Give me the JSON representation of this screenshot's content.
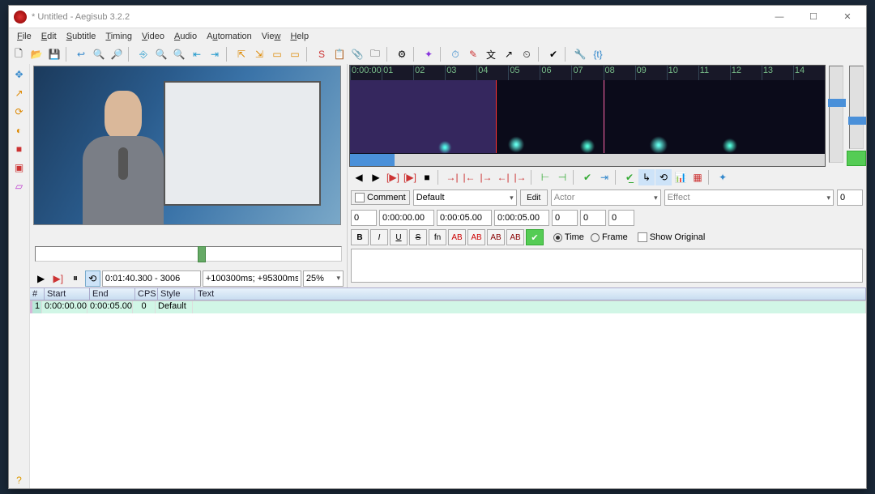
{
  "title": "* Untitled - Aegisub 3.2.2",
  "menus": [
    "File",
    "Edit",
    "Subtitle",
    "Timing",
    "Video",
    "Audio",
    "Automation",
    "View",
    "Help"
  ],
  "video": {
    "time_frame": "0:01:40.300 - 3006",
    "delay_info": "+100300ms; +95300ms",
    "zoom": "25%"
  },
  "audio_ruler": [
    "0:00:00",
    "01",
    "02",
    "03",
    "04",
    "05",
    "06",
    "07",
    "08",
    "09",
    "10",
    "11",
    "12",
    "13",
    "14"
  ],
  "edit": {
    "comment_label": "Comment",
    "style_value": "Default",
    "edit_btn": "Edit",
    "actor_placeholder": "Actor",
    "effect_placeholder": "Effect",
    "margin_r_value": "0",
    "layer": "0",
    "start": "0:00:00.00",
    "end": "0:00:05.00",
    "duration": "0:00:05.00",
    "ml": "0",
    "mr": "0",
    "mv": "0",
    "time_label": "Time",
    "frame_label": "Frame",
    "show_orig": "Show Original",
    "fmt": {
      "B": "B",
      "I": "I",
      "U": "U",
      "S": "S",
      "fn": "fn",
      "ab1": "AB",
      "ab2": "AB",
      "ab3": "AB",
      "ab4": "AB"
    }
  },
  "grid": {
    "headers": {
      "n": "#",
      "start": "Start",
      "end": "End",
      "cps": "CPS",
      "style": "Style",
      "text": "Text"
    },
    "rows": [
      {
        "n": "1",
        "start": "0:00:00.00",
        "end": "0:00:05.00",
        "cps": "0",
        "style": "Default",
        "text": ""
      }
    ]
  }
}
